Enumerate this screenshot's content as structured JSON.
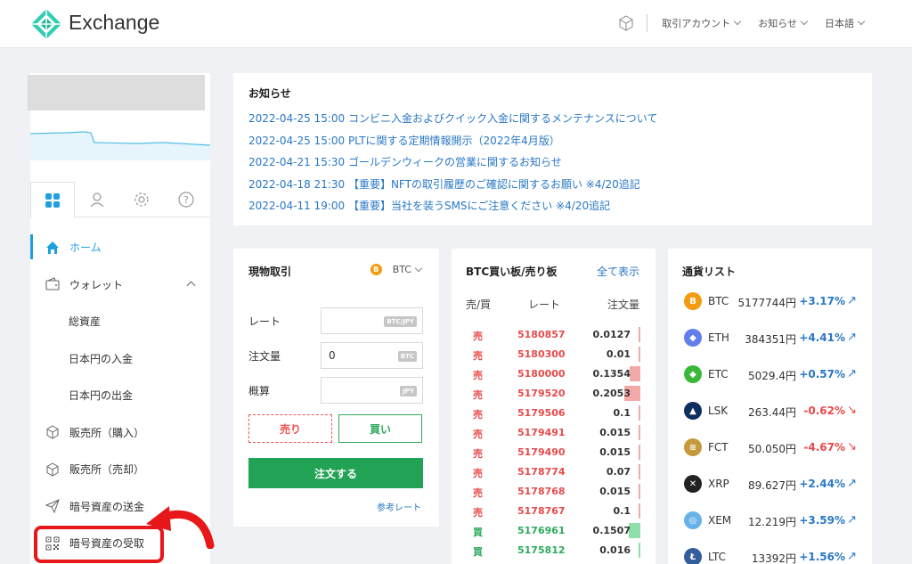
{
  "header": {
    "brand": "Exchange",
    "nav": [
      "取引アカウント",
      "お知らせ",
      "日本語"
    ]
  },
  "sidebar": {
    "items": [
      {
        "label": "ホーム",
        "icon": "home-icon",
        "active": true
      },
      {
        "label": "ウォレット",
        "icon": "wallet-icon",
        "expanded": true
      },
      {
        "label": "総資産",
        "sub": true
      },
      {
        "label": "日本円の入金",
        "sub": true
      },
      {
        "label": "日本円の出金",
        "sub": true
      },
      {
        "label": "販売所（購入）",
        "icon": "cube-icon"
      },
      {
        "label": "販売所（売却）",
        "icon": "cube-icon"
      },
      {
        "label": "暗号資産の送金",
        "icon": "send-icon"
      },
      {
        "label": "暗号資産の受取",
        "icon": "qr-code-icon"
      }
    ]
  },
  "notice": {
    "title": "お知らせ",
    "items": [
      "2022-04-25 15:00 コンビニ入金およびクイック入金に関するメンテナンスについて",
      "2022-04-25 15:00 PLTに関する定期情報開示（2022年4月版）",
      "2022-04-21 15:30 ゴールデンウィークの営業に関するお知らせ",
      "2022-04-18 21:30 【重要】NFTの取引履歴のご確認に関するお願い ※4/20追記",
      "2022-04-11 19:00 【重要】当社を装うSMSにご注意ください ※4/20追記"
    ]
  },
  "spot": {
    "title": "現物取引",
    "pair": "BTC",
    "coin_glyph": "B",
    "rate_label": "レート",
    "rate_unit": "BTC/JPY",
    "qty_label": "注文量",
    "qty_value": "0",
    "qty_unit": "BTC",
    "est_label": "概算",
    "est_unit": "JPY",
    "sell": "売り",
    "buy": "買い",
    "order": "注文する",
    "ref": "参考レート"
  },
  "book": {
    "title": "BTC買い板/売り板",
    "show_all": "全て表示",
    "headers": [
      "売/買",
      "レート",
      "注文量"
    ],
    "sell_color": "#e84a4a",
    "buy_color": "#2eaa5c",
    "rows": [
      {
        "side": "売",
        "rate": "5180857",
        "qty": "0.0127",
        "bar": 0.02
      },
      {
        "side": "売",
        "rate": "5180300",
        "qty": "0.01",
        "bar": 0.02
      },
      {
        "side": "売",
        "rate": "5180000",
        "qty": "0.1354",
        "bar": 0.3
      },
      {
        "side": "売",
        "rate": "5179520",
        "qty": "0.2053",
        "bar": 0.45
      },
      {
        "side": "売",
        "rate": "5179506",
        "qty": "0.1",
        "bar": 0.06
      },
      {
        "side": "売",
        "rate": "5179491",
        "qty": "0.015",
        "bar": 0.02
      },
      {
        "side": "売",
        "rate": "5179490",
        "qty": "0.015",
        "bar": 0.02
      },
      {
        "side": "売",
        "rate": "5178774",
        "qty": "0.07",
        "bar": 0.06
      },
      {
        "side": "売",
        "rate": "5178768",
        "qty": "0.015",
        "bar": 0.02
      },
      {
        "side": "売",
        "rate": "5178767",
        "qty": "0.1",
        "bar": 0.06
      },
      {
        "side": "買",
        "rate": "5176961",
        "qty": "0.1507",
        "bar": 0.33
      },
      {
        "side": "買",
        "rate": "5175812",
        "qty": "0.016",
        "bar": 0.02
      }
    ]
  },
  "currencies": {
    "title": "通貨リスト",
    "up_color": "#2a78c5",
    "down_color": "#e84a4a",
    "items": [
      {
        "name": "BTC",
        "price": "5177744円",
        "change": "+3.17%",
        "dir": "up",
        "color": "#f39b12",
        "glyph": "B"
      },
      {
        "name": "ETH",
        "price": "384351円",
        "change": "+4.41%",
        "dir": "up",
        "color": "#627eea",
        "glyph": "◆"
      },
      {
        "name": "ETC",
        "price": "5029.4円",
        "change": "+0.57%",
        "dir": "up",
        "color": "#3ab83a",
        "glyph": "◆"
      },
      {
        "name": "LSK",
        "price": "263.44円",
        "change": "-0.62%",
        "dir": "down",
        "color": "#0d2e5e",
        "glyph": "▲"
      },
      {
        "name": "FCT",
        "price": "50.050円",
        "change": "-4.67%",
        "dir": "down",
        "color": "#c49a3c",
        "glyph": "≋"
      },
      {
        "name": "XRP",
        "price": "89.627円",
        "change": "+2.44%",
        "dir": "up",
        "color": "#222222",
        "glyph": "✕"
      },
      {
        "name": "XEM",
        "price": "12.219円",
        "change": "+3.59%",
        "dir": "up",
        "color": "#67b2e8",
        "glyph": "◎"
      },
      {
        "name": "LTC",
        "price": "13392円",
        "change": "+1.56%",
        "dir": "up",
        "color": "#345d9d",
        "glyph": "Ł"
      }
    ]
  }
}
